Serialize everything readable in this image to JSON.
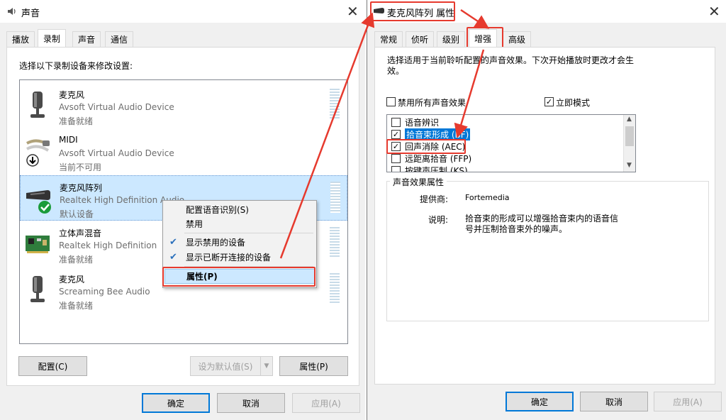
{
  "left_window": {
    "title": "声音",
    "tabs": [
      "播放",
      "录制",
      "声音",
      "通信"
    ],
    "active_tab": "录制",
    "instruction": "选择以下录制设备来修改设置:",
    "devices": [
      {
        "name": "麦克风",
        "driver": "Avsoft Virtual Audio Device",
        "status": "准备就绪",
        "icon": "microphone-icon"
      },
      {
        "name": "MIDI",
        "driver": "Avsoft Virtual Audio Device",
        "status": "当前不可用",
        "icon": "midi-cable-icon"
      },
      {
        "name": "麦克风阵列",
        "driver": "Realtek High Definition Audio",
        "status": "默认设备",
        "icon": "mic-array-icon"
      },
      {
        "name": "立体声混音",
        "driver": "Realtek High Definition",
        "status": "准备就绪",
        "icon": "sound-card-icon"
      },
      {
        "name": "麦克风",
        "driver": "Screaming Bee Audio",
        "status": "准备就绪",
        "icon": "microphone-icon"
      }
    ],
    "context_menu": [
      {
        "label": "配置语音识别(S)",
        "checked": false
      },
      {
        "label": "禁用",
        "checked": false
      },
      {
        "label": "显示禁用的设备",
        "checked": true
      },
      {
        "label": "显示已断开连接的设备",
        "checked": true
      },
      {
        "label": "属性(P)",
        "checked": false,
        "highlighted": true
      }
    ],
    "buttons": {
      "configure": "配置(C)",
      "set_default": "设为默认值(S)",
      "properties": "属性(P)",
      "ok": "确定",
      "cancel": "取消",
      "apply": "应用(A)"
    }
  },
  "right_window": {
    "title": "麦克风阵列 属性",
    "tabs": [
      "常规",
      "侦听",
      "级别",
      "增强",
      "高级"
    ],
    "active_tab": "增强",
    "description": "选择适用于当前聆听配置的声音效果。下次开始播放时更改才会生效。",
    "disable_all_label": "禁用所有声音效果",
    "disable_all_checked": false,
    "immediate_mode_label": "立即模式",
    "immediate_mode_checked": true,
    "effects": [
      {
        "label": "语音辨识",
        "checked": false
      },
      {
        "label": "拾音束形成 (BF)",
        "checked": true,
        "selected": true
      },
      {
        "label": "回声消除 (AEC)",
        "checked": true
      },
      {
        "label": "远距离拾音 (FFP)",
        "checked": false
      },
      {
        "label": "按键声压制 (KS)",
        "checked": false
      }
    ],
    "properties_group": {
      "title": "声音效果属性",
      "provider_label": "提供商:",
      "provider_value": "Fortemedia",
      "description_label": "说明:",
      "description_value": "拾音束的形成可以增强拾音束内的语音信号并压制拾音束外的噪声。"
    },
    "buttons": {
      "ok": "确定",
      "cancel": "取消",
      "apply": "应用(A)"
    }
  },
  "colors": {
    "annotation_red": "#e63a2e",
    "selection_blue": "#0078d7",
    "selected_row": "#cce8ff"
  }
}
